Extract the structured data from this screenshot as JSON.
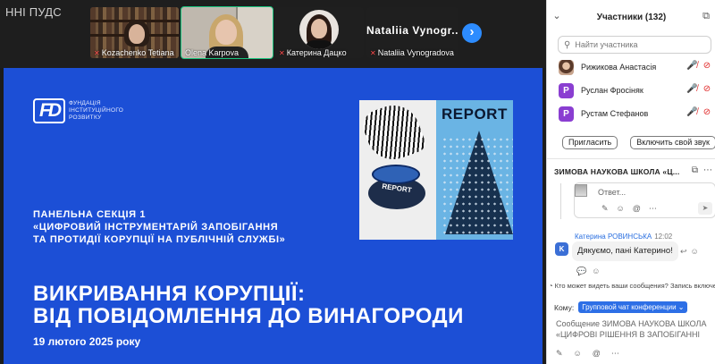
{
  "meeting": {
    "name": "ННІ ПУДС",
    "tiles": [
      {
        "name": "Kozachenko Tetiana"
      },
      {
        "name": "Olena Karpova"
      },
      {
        "name": "Катерина Дацко"
      },
      {
        "name": "Nataliia Vynogradova",
        "display": "Nataliia  Vynogr..."
      }
    ]
  },
  "slide": {
    "logo_text": "ФУНДАЦІЯ ІНСТИТУЦІЙНОГО РОЗВИТКУ",
    "poster_label_top": "REPORT",
    "poster_button": "REPORT",
    "session": [
      "ПАНЕЛЬНА СЕКЦІЯ 1",
      "«ЦИФРОВИЙ   ІНСТРУМЕНТАРІЙ   ЗАПОБІГАННЯ",
      "ТА ПРОТИДІЇ КОРУПЦІЇ НА ПУБЛІЧНІЙ СЛУЖБІ»"
    ],
    "title": [
      "ВИКРИВАННЯ КОРУПЦІЇ:",
      "ВІД ПОВІДОМЛЕННЯ ДО ВИНАГОРОДИ"
    ],
    "date": "19 лютого 2025 року"
  },
  "panel": {
    "title": "Участники (132)",
    "search_placeholder": "Найти участника",
    "participants": [
      {
        "name": "Рижикова Анастасія",
        "initial": ""
      },
      {
        "name": "Руслан Фросіняк",
        "initial": "Р"
      },
      {
        "name": "Рустам Стефанов",
        "initial": "Р"
      }
    ],
    "invite_label": "Пригласить",
    "unmute_label": "Включить свой звук",
    "chat_title": "ЗИМОВА НАУКОВА ШКОЛА «Ц...",
    "reply_placeholder": "Ответ...",
    "message": {
      "initial": "K",
      "author": "Катерина РОВИНСЬКА",
      "time": "12:02",
      "text": "Дякуємо, пані Катерино!"
    },
    "who_can_see": "Кто может видеть ваши сообщения? Запись включена",
    "to_label": "Кому:",
    "to_value": "Групповой чат конференции",
    "compose": [
      "Сообщение ЗИМОВА НАУКОВА ШКОЛА",
      "«ЦИФРОВІ РІШЕННЯ В ЗАПОБІГАННІ"
    ]
  }
}
